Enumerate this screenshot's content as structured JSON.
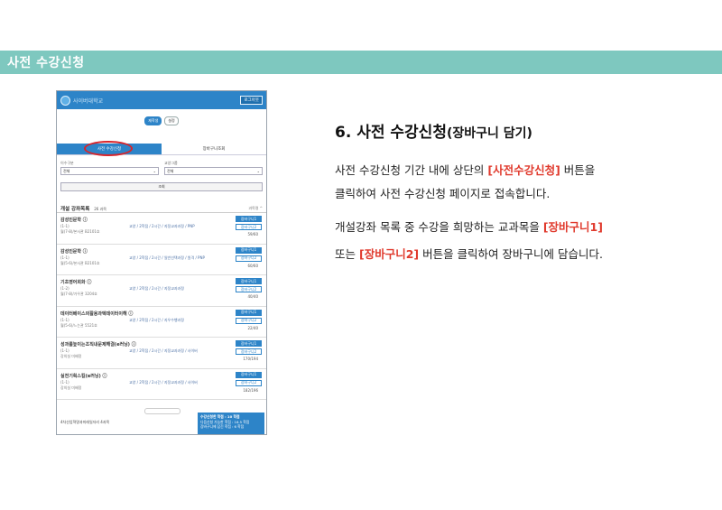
{
  "section_title": "사전 수강신청",
  "phone": {
    "logo_text": "사이버대학교",
    "logout_label": "로그아웃",
    "toggle_chips": [
      "재학생",
      "설정"
    ],
    "tabs": [
      "사전 수강신청",
      "장바구니조회"
    ],
    "filters": [
      {
        "label": "이수구분",
        "value": "전체"
      },
      {
        "label": "교양그룹",
        "value": "전체"
      }
    ],
    "search_label": "조회",
    "list_title": "개설 강좌목록",
    "list_count": "26 과목",
    "sort_label": "과목명 ^",
    "courses": [
      {
        "name": "감성인문학 ⓘ",
        "sub1": "(1-1)",
        "sub2": "월(7-8)/본사관 B2101호",
        "info": "교양 / 2학점 / 2시간 / 지정교과과정 / PNP",
        "cap": "59/60"
      },
      {
        "name": "감성인문학 ⓘ",
        "sub1": "(1-1)",
        "sub2": "월(5-6)/본사관 B2101호",
        "info": "교양 / 2학점 / 2시간 / 일반선택과정 / 원격 / PNP",
        "cap": "60/60"
      },
      {
        "name": "기초영어회화 ⓘ",
        "sub1": "(1-2)",
        "sub2": "월(7-8)/가우관 3204호",
        "info": "교양 / 2학점 / 2시간 / 지정교과과정",
        "cap": "40/40"
      },
      {
        "name": "데이터베이스의활용과텍데이터이해 ⓘ",
        "sub1": "(1-1)",
        "sub2": "월(5-6)/느는관 5521호",
        "info": "교양 / 2학점 / 2시간 / 지우수행과정",
        "cap": "22/40"
      },
      {
        "name": "성과를높이는조직내문제해결(e러닝) ⓘ",
        "sub1": "(1-1)",
        "sub2": "강의실 미배정",
        "info": "교양 / 2학점 / 2시간 / 지정교과과정 / 사이버",
        "cap": "170/194"
      },
      {
        "name": "실전기획스킬(e러닝) ⓘ",
        "sub1": "(1-1)",
        "sub2": "강의실 미배정",
        "info": "교양 / 2학점 / 2시간 / 지정교과과정 / 사이버",
        "cap": "182/196"
      }
    ],
    "cart1_label": "장바구니1",
    "cart2_label": "장바구니2",
    "footer_note": "4차산업혁명과미래일자리 4과목",
    "footer_box_lines": [
      "수강신청한 학점 : 10 학점",
      "다음신청 가능한 학점 : 16.5 학점",
      "장바구니에 담긴 학점 : 6 학점"
    ]
  },
  "heading_main": "6. 사전 수강신청",
  "heading_sub": "(장바구니 담기)",
  "para1": {
    "pre": "사전 수강신청 기간 내에 상단의 ",
    "highlight": "[사전수강신청]",
    "post": " 버튼을"
  },
  "para2": "클릭하여 사전 수강신청 페이지로 접속합니다.",
  "para3": {
    "pre": "개설강좌 목록 중 수강을 희망하는 교과목을 ",
    "highlight": "[장바구니1]"
  },
  "para4": {
    "pre": "또는 ",
    "highlight": "[장바구니2]",
    "post": " 버튼을 클릭하여 장바구니에 담습니다."
  },
  "colors": {
    "accent_bar": "#7ec8bf",
    "highlight": "#e03a2d",
    "app_blue": "#2d84c8"
  }
}
